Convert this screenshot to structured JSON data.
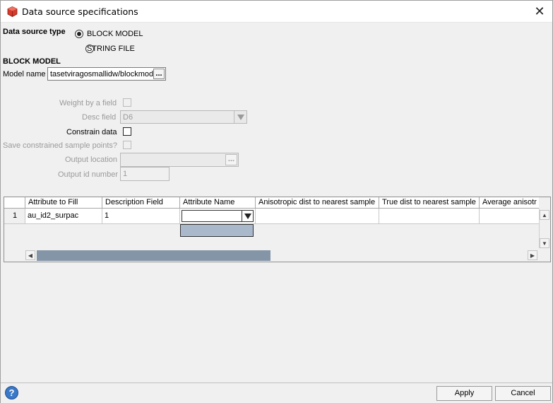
{
  "window": {
    "title": "Data source specifications",
    "icon": "app-cube-icon",
    "close_glyph": "✕"
  },
  "source_type": {
    "label": "Data source type",
    "options": [
      {
        "label": "BLOCK MODEL",
        "selected": true
      },
      {
        "label": "STRING FILE",
        "selected": false
      }
    ]
  },
  "block_model": {
    "heading": "BLOCK MODEL",
    "model_name_label": "Model name",
    "model_name_value": "tasetviragosmallidw/blockmod",
    "browse_label": "..."
  },
  "options": {
    "weight_label": "Weight by a field",
    "desc_label": "Desc field",
    "desc_value": "D6",
    "constrain_label": "Constrain data",
    "save_label": "Save constrained sample points?",
    "output_location_label": "Output location",
    "output_location_value": "",
    "output_browse_label": "...",
    "output_id_label": "Output id number",
    "output_id_value": "1"
  },
  "table": {
    "columns": [
      "Attribute to Fill",
      "Description Field",
      "Attribute Name",
      "Anisotropic dist to nearest sample",
      "True dist to nearest sample",
      "Average anisotr"
    ],
    "rows": [
      {
        "index": "1",
        "cells": [
          "au_id2_surpac",
          "1",
          "",
          "",
          "",
          ""
        ]
      }
    ]
  },
  "footer": {
    "help_icon": "help-icon",
    "apply_label": "Apply",
    "cancel_label": "Cancel"
  }
}
